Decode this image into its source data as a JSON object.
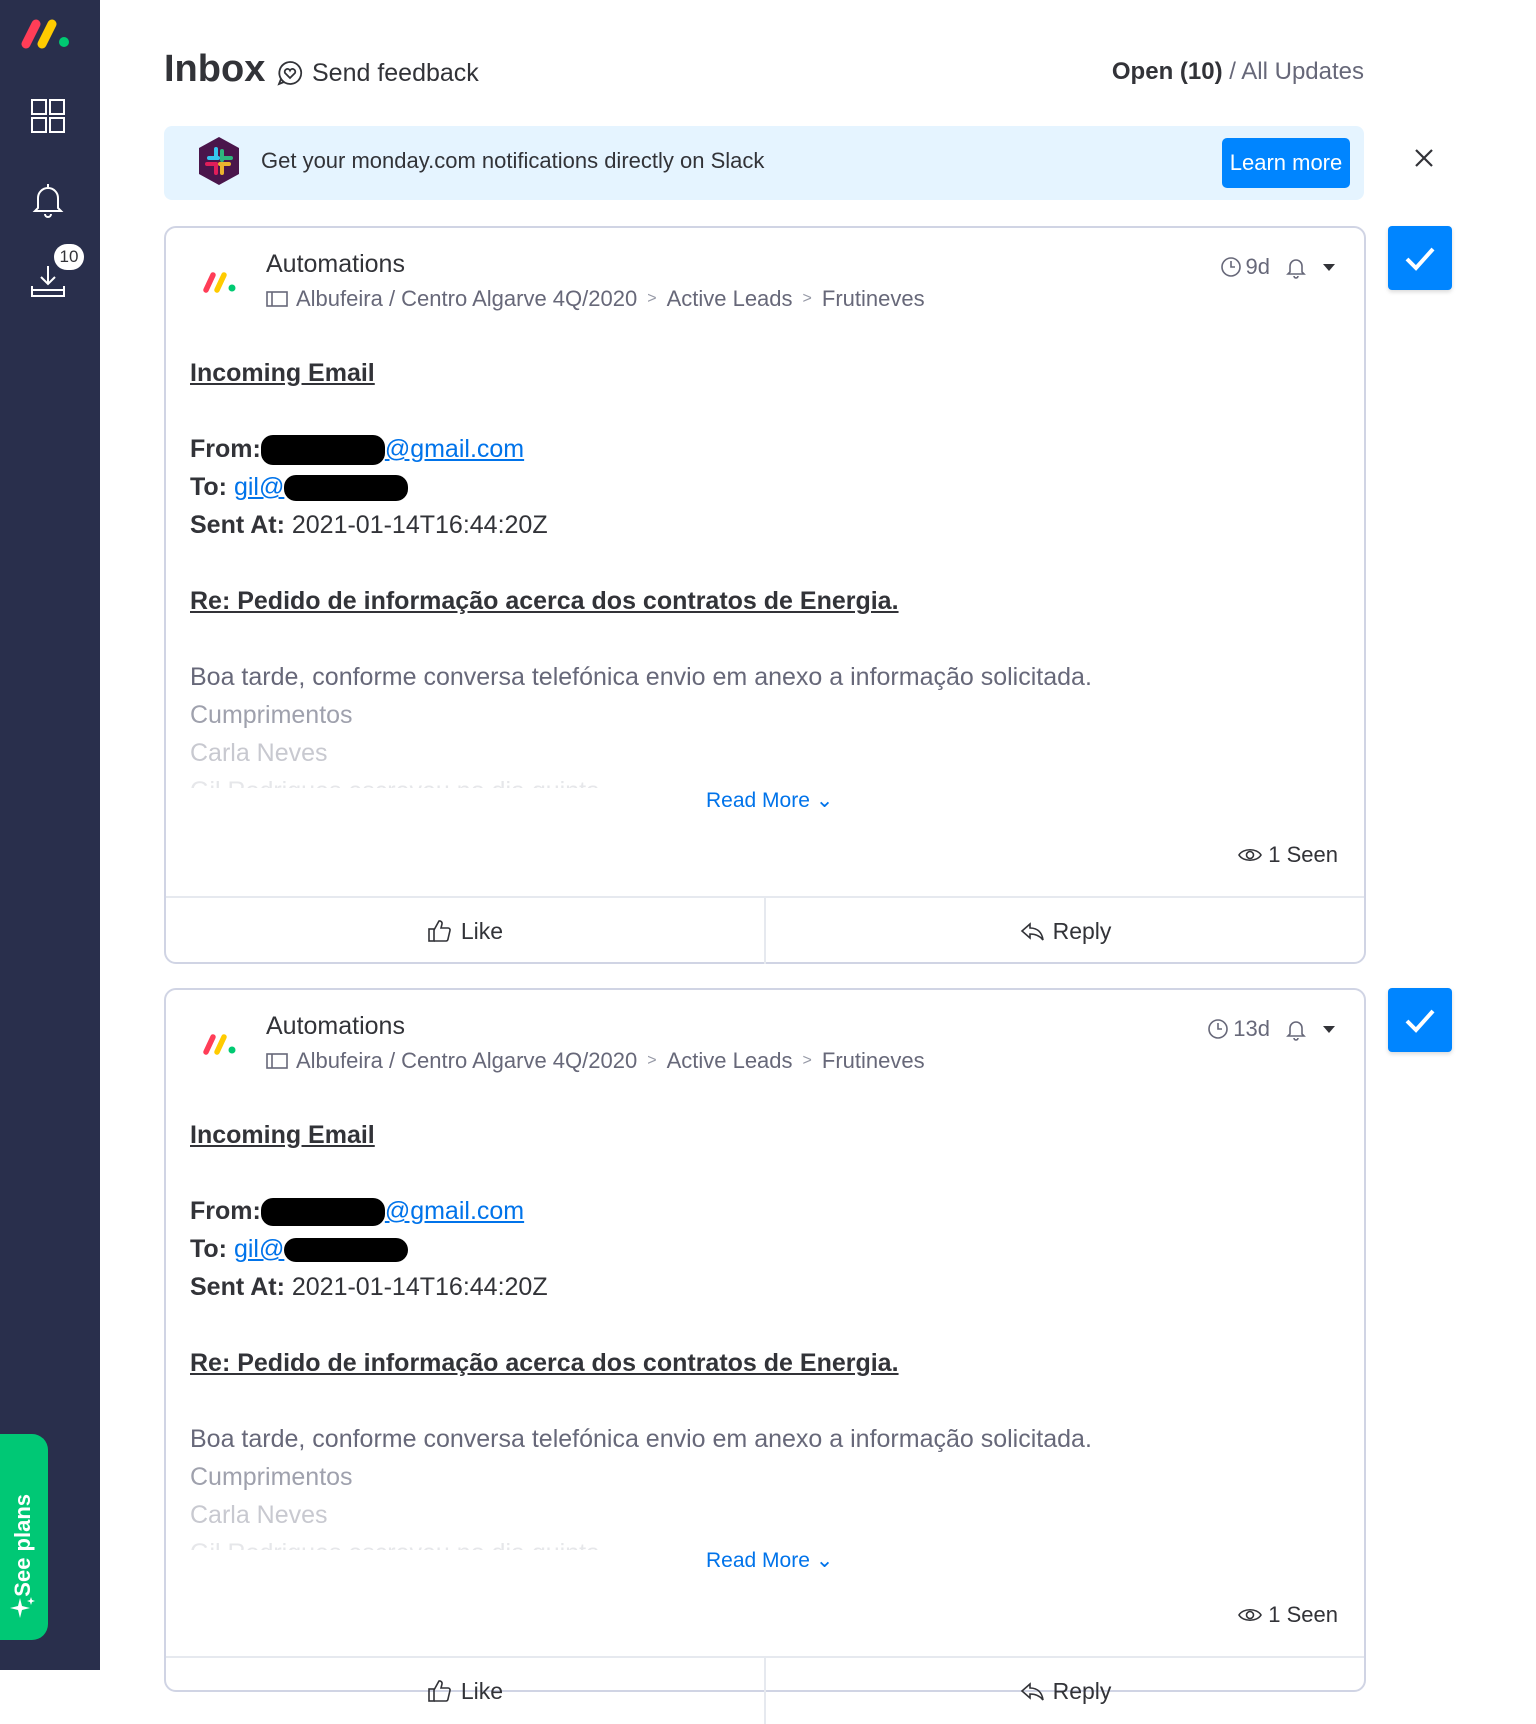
{
  "sidebar": {
    "badge_count": "10",
    "see_plans_label": "See plans",
    "icons": [
      "monday-logo-icon",
      "grid-icon",
      "bell-icon",
      "inbox-download-icon",
      "sparkle-icon"
    ]
  },
  "header": {
    "title": "Inbox",
    "feedback_label": "Send feedback",
    "filter_open": "Open (10)",
    "filter_sep": " / ",
    "filter_all": "All Updates"
  },
  "banner": {
    "text": "Get your monday.com notifications directly on Slack",
    "button": "Learn more",
    "accent": "#0085ff",
    "background": "#e5f4ff"
  },
  "updates": [
    {
      "author": "Automations",
      "board": "Albufeira / Centro Algarve 4Q/2020",
      "group": "Active Leads",
      "item": "Frutineves",
      "age": "9d",
      "heading": "Incoming Email",
      "from_label": "From:",
      "from_value": "@gmail.com",
      "to_label": "To:",
      "to_value": "gil@",
      "sent_label": "Sent At:",
      "sent_value": "2021-01-14T16:44:20Z",
      "subject": "Re: Pedido de informação acerca dos contratos de Energia.",
      "line1": "Boa tarde, conforme conversa telefónica envio em anexo a informação solicitada.",
      "line2": "Cumprimentos",
      "line3": "Carla Neves",
      "line4": "Gil Rodrigues escreveu no dia quinta",
      "read_more": "Read More",
      "seen": "1 Seen",
      "like": "Like",
      "reply": "Reply"
    },
    {
      "author": "Automations",
      "board": "Albufeira / Centro Algarve 4Q/2020",
      "group": "Active Leads",
      "item": "Frutineves",
      "age": "13d",
      "heading": "Incoming Email",
      "from_label": "From:",
      "from_value": "@gmail.com",
      "to_label": "To:",
      "to_value": "gil@",
      "sent_label": "Sent At:",
      "sent_value": "2021-01-14T16:44:20Z",
      "subject": "Re: Pedido de informação acerca dos contratos de Energia.",
      "line1": "Boa tarde, conforme conversa telefónica envio em anexo a informação solicitada.",
      "line2": "Cumprimentos",
      "line3": "Carla Neves",
      "line4": "Gil Rodrigues escreveu no dia quinta",
      "read_more": "Read More",
      "seen": "1 Seen",
      "like": "Like",
      "reply": "Reply"
    }
  ]
}
